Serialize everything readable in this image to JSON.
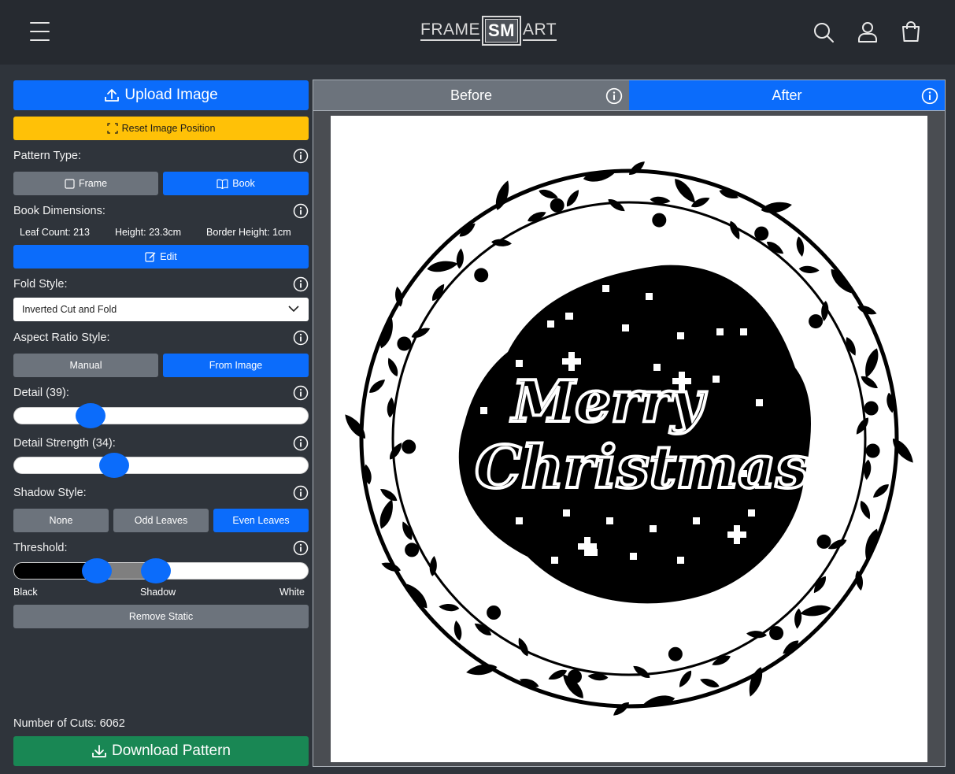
{
  "header": {
    "logo_left": "FRAME",
    "logo_mid": "SM",
    "logo_right": "ART",
    "icons": [
      "hamburger-icon",
      "search-icon",
      "user-icon",
      "cart-icon"
    ]
  },
  "sidebar": {
    "upload_label": "Upload Image",
    "reset_label": "Reset Image Position",
    "pattern_type_label": "Pattern Type:",
    "pattern_types": [
      {
        "label": "Frame",
        "active": false
      },
      {
        "label": "Book",
        "active": true
      }
    ],
    "book_dimensions_label": "Book Dimensions:",
    "leaf_count": "Leaf Count: 213",
    "height": "Height: 23.3cm",
    "border_height": "Border Height: 1cm",
    "edit_label": "Edit",
    "fold_style_label": "Fold Style:",
    "fold_style_value": "Inverted Cut and Fold",
    "aspect_ratio_label": "Aspect Ratio Style:",
    "aspect_ratio_options": [
      {
        "label": "Manual",
        "active": false
      },
      {
        "label": "From Image",
        "active": true
      }
    ],
    "detail_label": "Detail (39):",
    "detail_value": 39,
    "detail_strength_label": "Detail Strength (34):",
    "detail_strength_value": 34,
    "shadow_style_label": "Shadow Style:",
    "shadow_options": [
      {
        "label": "None",
        "active": false
      },
      {
        "label": "Odd Leaves",
        "active": false
      },
      {
        "label": "Even Leaves",
        "active": true
      }
    ],
    "threshold_label": "Threshold:",
    "threshold_black": "Black",
    "threshold_shadow": "Shadow",
    "threshold_white": "White",
    "remove_static_label": "Remove Static",
    "cuts_label": "Number of Cuts: 6062",
    "download_label": "Download Pattern"
  },
  "preview": {
    "tabs": [
      {
        "label": "Before",
        "active": false
      },
      {
        "label": "After",
        "active": true
      }
    ],
    "image_text_line1": "Merry",
    "image_text_line2": "Christmas"
  },
  "colors": {
    "primary": "#0b6cfb",
    "warning": "#ffc107",
    "success": "#198754",
    "secondary": "#6c737c",
    "background": "#2f343b",
    "header": "#262a30"
  }
}
